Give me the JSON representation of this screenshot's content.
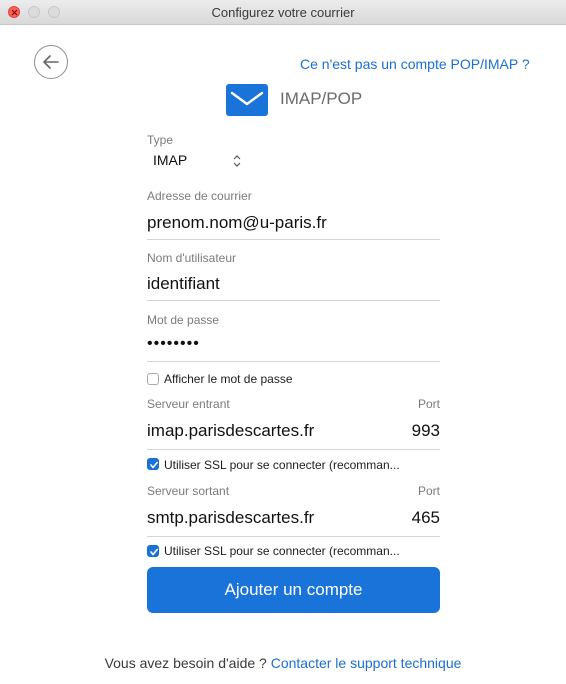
{
  "window": {
    "title": "Configurez votre courrier"
  },
  "header": {
    "not_pop_link": "Ce n'est pas un compte POP/IMAP ?",
    "title": "IMAP/POP",
    "icons": {
      "back": "back-arrow-icon",
      "mail": "envelope-icon"
    }
  },
  "form": {
    "type": {
      "label": "Type",
      "value": "IMAP"
    },
    "email": {
      "label": "Adresse de courrier",
      "value": "prenom.nom@u-paris.fr"
    },
    "username": {
      "label": "Nom d'utilisateur",
      "value": "identifiant"
    },
    "password": {
      "label": "Mot de passe",
      "value": "••••••••"
    },
    "show_password": {
      "label": "Afficher le mot de passe",
      "checked": false
    },
    "incoming": {
      "label": "Serveur entrant",
      "port_label": "Port",
      "server": "imap.parisdescartes.fr",
      "port": "993"
    },
    "incoming_ssl": {
      "label": "Utiliser SSL pour se connecter (recomman...",
      "checked": true
    },
    "outgoing": {
      "label": "Serveur sortant",
      "port_label": "Port",
      "server": "smtp.parisdescartes.fr",
      "port": "465"
    },
    "outgoing_ssl": {
      "label": "Utiliser SSL pour se connecter (recomman...",
      "checked": true
    },
    "submit": "Ajouter un compte"
  },
  "footer": {
    "help_text": "Vous avez besoin d'aide ? ",
    "support_link": "Contacter le support technique"
  },
  "colors": {
    "accent": "#1a73d8",
    "link": "#1b6fd1"
  }
}
